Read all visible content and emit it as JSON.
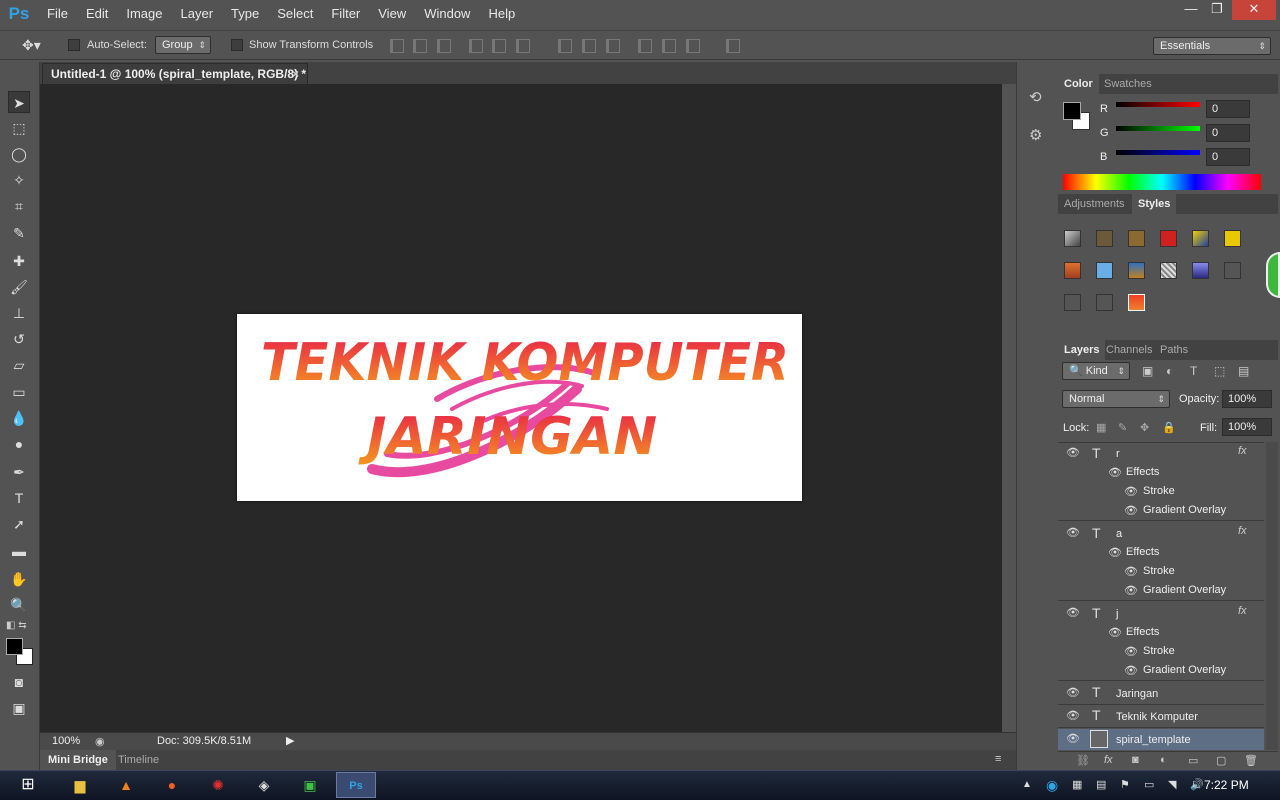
{
  "app": {
    "logo": "Ps"
  },
  "menu": [
    "File",
    "Edit",
    "Image",
    "Layer",
    "Type",
    "Select",
    "Filter",
    "View",
    "Window",
    "Help"
  ],
  "window_controls": {
    "minimize": "—",
    "maximize": "❐",
    "close": "✕"
  },
  "options_bar": {
    "auto_select_label": "Auto-Select:",
    "auto_select_value": "Group",
    "show_transform_label": "Show Transform Controls",
    "workspace": "Essentials"
  },
  "document": {
    "tab_title": "Untitled-1 @ 100% (spiral_template, RGB/8) *",
    "close": "×",
    "canvas_line1": "TEKNIK KOMPUTER",
    "canvas_line2": "JARINGAN"
  },
  "status": {
    "zoom": "100%",
    "doc_size": "Doc: 309.5K/8.51M"
  },
  "bottom_tabs": {
    "mini_bridge": "Mini Bridge",
    "timeline": "Timeline"
  },
  "color_panel": {
    "tab_color": "Color",
    "tab_swatches": "Swatches",
    "r_label": "R",
    "g_label": "G",
    "b_label": "B",
    "r": "0",
    "g": "0",
    "b": "0"
  },
  "styles_panel": {
    "tab_adjustments": "Adjustments",
    "tab_styles": "Styles"
  },
  "layers_panel": {
    "tab_layers": "Layers",
    "tab_channels": "Channels",
    "tab_paths": "Paths",
    "kind": "Kind",
    "blend_mode": "Normal",
    "opacity_label": "Opacity:",
    "opacity": "100%",
    "lock_label": "Lock:",
    "fill_label": "Fill:",
    "fill": "100%",
    "effects_label": "Effects",
    "stroke_label": "Stroke",
    "gradient_label": "Gradient Overlay",
    "fx": "fx",
    "layers": [
      {
        "name": "r"
      },
      {
        "name": "a"
      },
      {
        "name": "j"
      },
      {
        "name": "Jaringan"
      },
      {
        "name": "Teknik Komputer"
      },
      {
        "name": "spiral_template"
      }
    ]
  },
  "taskbar": {
    "time": "7:22 PM"
  },
  "colors": {
    "accent": "#2fa3e8",
    "text_gradient_top": "#e8204a",
    "text_gradient_bottom": "#f59b1e",
    "spiral": "#e84aa0"
  }
}
